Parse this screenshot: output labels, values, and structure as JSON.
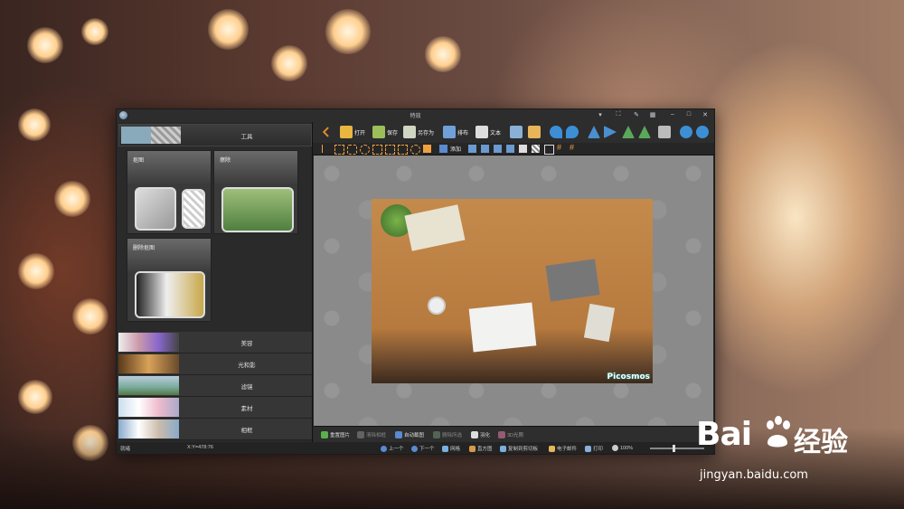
{
  "window": {
    "title": "特效",
    "controls": [
      "▾",
      "⛶",
      "✎",
      "▦",
      "–",
      "□",
      "✕"
    ]
  },
  "left_panel": {
    "header": {
      "label": "工具"
    },
    "tools": [
      {
        "label": "抠图"
      },
      {
        "label": "擦除"
      },
      {
        "label": "删除抠图"
      }
    ],
    "categories": [
      {
        "label": "美容"
      },
      {
        "label": "光和影"
      },
      {
        "label": "滤镜"
      },
      {
        "label": "素材"
      },
      {
        "label": "相框"
      }
    ]
  },
  "toolbar": {
    "open": "打开",
    "save": "保存",
    "save_as": "另存为",
    "layout": "排布",
    "text": "文本",
    "paste": "添加",
    "second_row_text": "添加"
  },
  "photo": {
    "watermark": "Picosmos"
  },
  "bottom_bar": {
    "reset": "重置图片",
    "clear_frame": "清除相框",
    "auto_crop": "自动截图",
    "delete_sel": "删除所选",
    "blur": "羽化",
    "light3d": "3D光照"
  },
  "status_bar": {
    "state": "就绪",
    "coords": "X:Y=478:76",
    "prev": "上一个",
    "next": "下一个",
    "grid": "网格",
    "histogram": "直方图",
    "copy_clip": "复制到剪切板",
    "email": "电子邮件",
    "print": "打印",
    "zoom": "100%"
  },
  "watermark_logo": {
    "brand_left": "Bai",
    "brand_right": "经验",
    "url": "jingyan.baidu.com"
  },
  "colors": {
    "accent": "#3c8fd4",
    "window_bg": "#2b2b2b",
    "canvas_bg": "#8a8a8a"
  }
}
